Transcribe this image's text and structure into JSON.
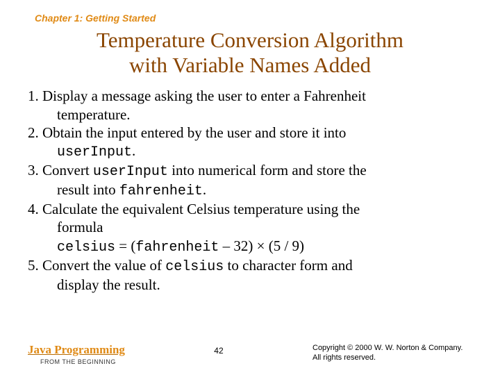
{
  "chapter": "Chapter 1: Getting Started",
  "title_line1": "Temperature Conversion Algorithm",
  "title_line2": "with Variable Names Added",
  "steps": {
    "s1a": "1. Display a message asking the user to enter a Fahrenheit",
    "s1b": "temperature.",
    "s2a": "2. Obtain the input entered by the user and store it into",
    "s2b_code": "userInput",
    "s2b_tail": ".",
    "s3a_pre": "3. Convert ",
    "s3a_code": "userInput",
    "s3a_post": " into numerical form and store the",
    "s3b_pre": "result into ",
    "s3b_code": "fahrenheit",
    "s3b_tail": ".",
    "s4a": "4. Calculate the equivalent Celsius temperature using the",
    "s4b": "formula",
    "s4c_code1": "celsius",
    "s4c_mid1": " = (",
    "s4c_code2": "fahrenheit",
    "s4c_mid2": " – 32) × (5 / 9)",
    "s5a_pre": "5. Convert the value of ",
    "s5a_code": "celsius",
    "s5a_post": " to character form and",
    "s5b": "display the result."
  },
  "footer": {
    "book_title": "Java Programming",
    "book_sub": "FROM THE BEGINNING",
    "page": "42",
    "copyright1": "Copyright © 2000 W. W. Norton & Company.",
    "copyright2": "All rights reserved."
  }
}
